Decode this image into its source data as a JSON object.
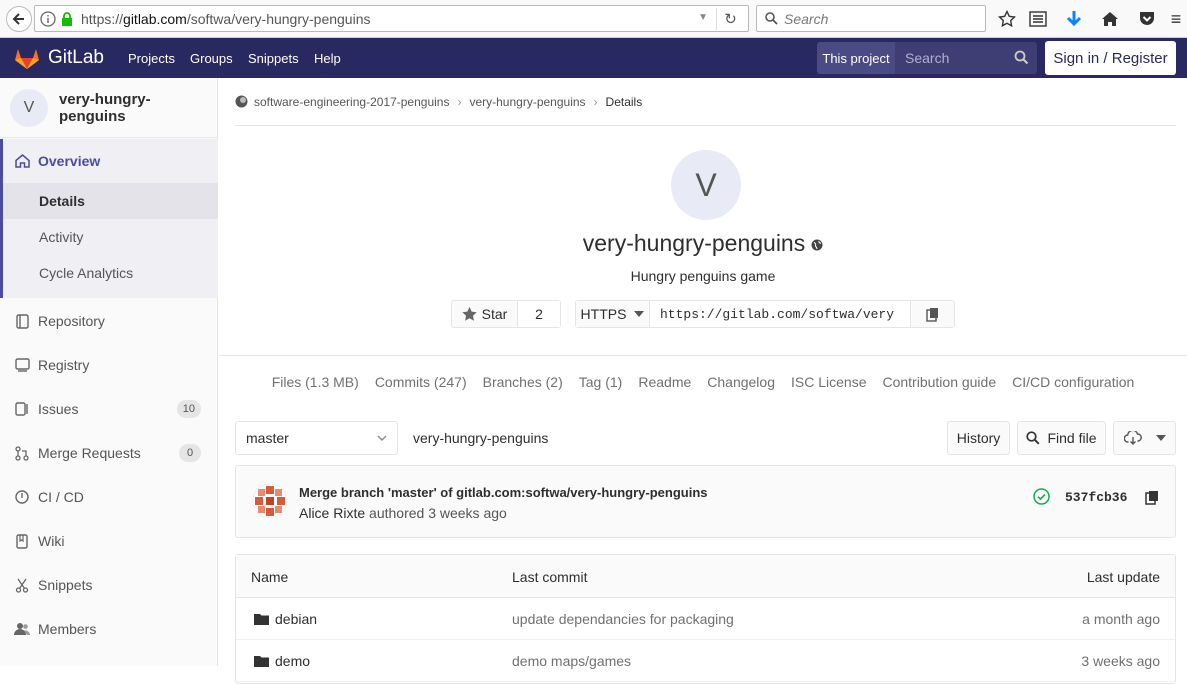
{
  "browser": {
    "url_prefix": "https://",
    "url_host": "gitlab.com",
    "url_path": "/softwa/very-hungry-penguins",
    "search_placeholder": "Search"
  },
  "topbar": {
    "brand": "GitLab",
    "nav": [
      "Projects",
      "Groups",
      "Snippets",
      "Help"
    ],
    "this_project": "This project",
    "search_placeholder": "Search",
    "signin": "Sign in / Register"
  },
  "sidebar": {
    "avatar_letter": "V",
    "project_name": "very-hungry-penguins",
    "overview": "Overview",
    "sub_items": [
      "Details",
      "Activity",
      "Cycle Analytics"
    ],
    "items": [
      {
        "label": "Repository",
        "icon": "book-icon",
        "badge": null
      },
      {
        "label": "Registry",
        "icon": "container-icon",
        "badge": null
      },
      {
        "label": "Issues",
        "icon": "issues-icon",
        "badge": "10"
      },
      {
        "label": "Merge Requests",
        "icon": "merge-request-icon",
        "badge": "0"
      },
      {
        "label": "CI / CD",
        "icon": "rocket-icon",
        "badge": null
      },
      {
        "label": "Wiki",
        "icon": "book-icon",
        "badge": null
      },
      {
        "label": "Snippets",
        "icon": "scissors-icon",
        "badge": null
      },
      {
        "label": "Members",
        "icon": "users-icon",
        "badge": null
      }
    ]
  },
  "breadcrumb": {
    "group": "software-engineering-2017-penguins",
    "project": "very-hungry-penguins",
    "current": "Details"
  },
  "project": {
    "avatar_letter": "V",
    "title": "very-hungry-penguins",
    "description": "Hungry penguins game",
    "star_label": "Star",
    "star_count": "2",
    "protocol": "HTTPS",
    "clone_url": "https://gitlab.com/softwa/very"
  },
  "stats": [
    "Files (1.3 MB)",
    "Commits (247)",
    "Branches (2)",
    "Tag (1)",
    "Readme",
    "Changelog",
    "ISC License",
    "Contribution guide",
    "CI/CD configuration"
  ],
  "tree": {
    "branch": "master",
    "path": "very-hungry-penguins",
    "history": "History",
    "find_file": "Find file"
  },
  "last_commit": {
    "title": "Merge branch 'master' of gitlab.com:softwa/very-hungry-penguins",
    "author": "Alice Rixte",
    "authored_text": "authored 3 weeks ago",
    "sha": "537fcb36",
    "status_color": "#1aaa55"
  },
  "files": {
    "headers": [
      "Name",
      "Last commit",
      "Last update"
    ],
    "rows": [
      {
        "name": "debian",
        "commit": "update dependancies for packaging",
        "updated": "a month ago"
      },
      {
        "name": "demo",
        "commit": "demo maps/games",
        "updated": "3 weeks ago"
      }
    ]
  },
  "colors": {
    "topbar": "#292961",
    "accent": "#4b4ba3"
  }
}
